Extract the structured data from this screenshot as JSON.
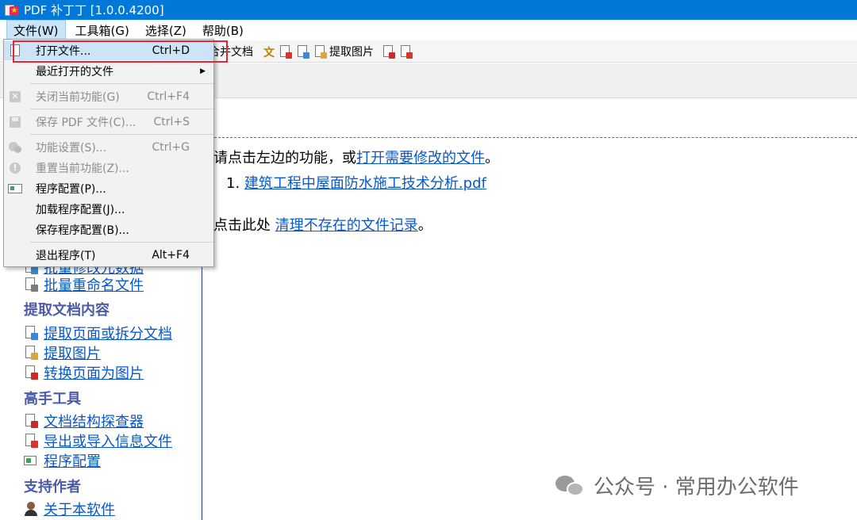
{
  "window": {
    "title": "PDF 补丁丁 [1.0.0.4200]"
  },
  "menubar": [
    {
      "label": "文件(W)"
    },
    {
      "label": "工具箱(G)"
    },
    {
      "label": "选择(Z)"
    },
    {
      "label": "帮助(B)"
    }
  ],
  "toolbar": {
    "merge_label": "合并文档",
    "extract_images_label": "提取图片"
  },
  "file_menu": [
    {
      "label": "打开文件...",
      "shortcut": "Ctrl+D",
      "state": "highlighted"
    },
    {
      "label": "最近打开的文件",
      "shortcut": "",
      "state": "submenu"
    },
    {
      "label": "关闭当前功能(G)",
      "shortcut": "Ctrl+F4",
      "state": "disabled"
    },
    {
      "label": "保存 PDF 文件(C)...",
      "shortcut": "Ctrl+S",
      "state": "disabled"
    },
    {
      "label": "功能设置(S)...",
      "shortcut": "Ctrl+G",
      "state": "disabled"
    },
    {
      "label": "重置当前功能(Z)...",
      "shortcut": "",
      "state": "disabled"
    },
    {
      "label": "程序配置(P)...",
      "shortcut": "",
      "state": "normal"
    },
    {
      "label": "加载程序配置(J)...",
      "shortcut": "",
      "state": "normal"
    },
    {
      "label": "保存程序配置(B)...",
      "shortcut": "",
      "state": "normal"
    },
    {
      "label": "退出程序(T)",
      "shortcut": "Alt+F4",
      "state": "normal"
    }
  ],
  "main": {
    "intro_prefix": "请点击左边的功能，或",
    "intro_link": "打开需要修改的文件",
    "intro_suffix": "。",
    "recent_number": "1.",
    "recent_file": "建筑工程中屋面防水施工技术分析.pdf",
    "cleanup_prefix": "点击此处 ",
    "cleanup_link": "清理不存在的文件记录",
    "cleanup_suffix": "。"
  },
  "sidebar": {
    "partial_item": "批量修改元数据",
    "items_top": [
      {
        "label": "批量重命名文件",
        "icon": "rename-icon"
      }
    ],
    "section_extract": "提取文档内容",
    "items_extract": [
      {
        "label": "提取页面或拆分文档",
        "icon": "split-pages-icon"
      },
      {
        "label": "提取图片",
        "icon": "extract-images-icon"
      },
      {
        "label": "转换页面为图片",
        "icon": "pages-to-images-icon"
      }
    ],
    "section_expert": "高手工具",
    "items_expert": [
      {
        "label": "文档结构探查器",
        "icon": "structure-explorer-icon"
      },
      {
        "label": "导出或导入信息文件",
        "icon": "export-import-icon"
      },
      {
        "label": "程序配置",
        "icon": "settings-icon"
      }
    ],
    "section_support": "支持作者",
    "items_support": [
      {
        "label": "关于本软件",
        "icon": "author-icon"
      }
    ]
  },
  "watermark": {
    "text": "公众号 · 常用办公软件"
  },
  "colors": {
    "titlebar": "#0078d7",
    "link": "#0a58ca",
    "highlight_box": "#e0263b",
    "menu_hover": "#cce4f7"
  }
}
